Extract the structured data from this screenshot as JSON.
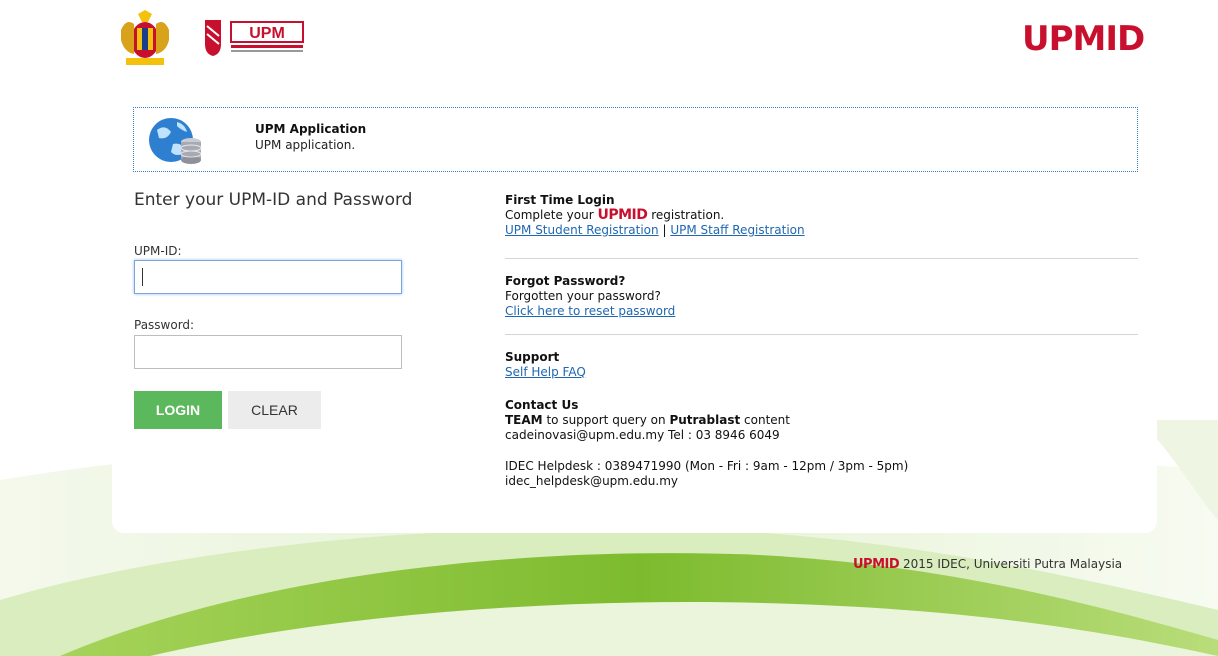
{
  "header": {
    "brand_text": "UPMID",
    "upm_logo_text": "UPM"
  },
  "app": {
    "title": "UPM Application",
    "description": "UPM application."
  },
  "login_form": {
    "heading": "Enter your UPM-ID and Password",
    "upmid_label": "UPM-ID:",
    "upmid_value": "",
    "password_label": "Password:",
    "password_value": "",
    "login_label": "LOGIN",
    "clear_label": "CLEAR"
  },
  "first_time": {
    "title": "First Time Login",
    "text_before": "Complete your",
    "brand": "UPMID",
    "text_after": "registration.",
    "student_link": "UPM Student Registration",
    "separator": "|",
    "staff_link": "UPM Staff Registration"
  },
  "forgot": {
    "title": "Forgot Password?",
    "text": "Forgotten your password?",
    "link": "Click here to reset password"
  },
  "support": {
    "title": "Support",
    "link": "Self Help FAQ"
  },
  "contact": {
    "title": "Contact Us",
    "team": "TEAM",
    "text_mid": "to support query on",
    "putrablast": "Putrablast",
    "text_end": "content",
    "email_line": "cadeinovasi@upm.edu.my Tel : 03 8946 6049",
    "helpdesk": "IDEC Helpdesk : 0389471990 (Mon - Fri : 9am - 12pm / 3pm - 5pm)",
    "helpdesk_email": "idec_helpdesk@upm.edu.my"
  },
  "footer": {
    "brand": "UPMID",
    "text": "2015 IDEC, Universiti Putra Malaysia"
  },
  "colors": {
    "brand_red": "#c8102e",
    "login_green": "#5cb85c",
    "link_blue": "#1f67b1",
    "swoosh_green": "#8cc63f"
  }
}
